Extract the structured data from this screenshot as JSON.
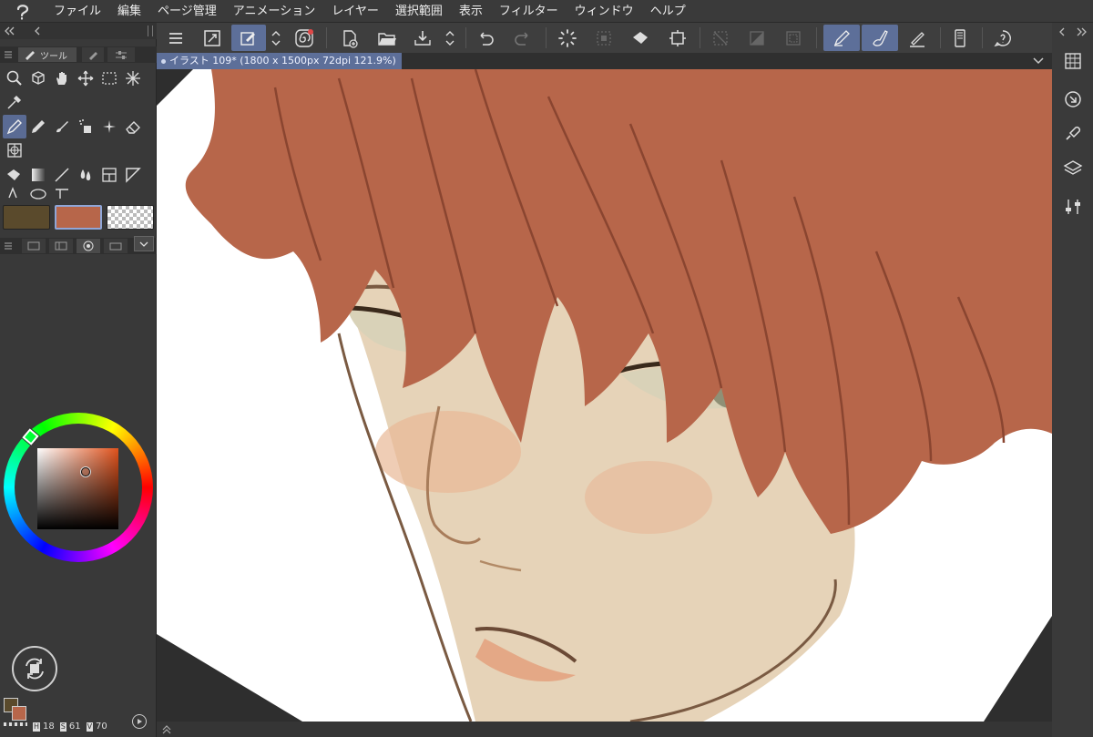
{
  "menubar": {
    "items": [
      "ファイル",
      "編集",
      "ページ管理",
      "アニメーション",
      "レイヤー",
      "選択範囲",
      "表示",
      "フィルター",
      "ウィンドウ",
      "ヘルプ"
    ]
  },
  "command_bar": {
    "icons": [
      "menu-icon",
      "fit-view-icon",
      "edit-canvas-icon",
      "updown-icon",
      "spiral-icon",
      "new-file-icon",
      "open-folder-icon",
      "save-icon",
      "updown-icon",
      "undo-icon",
      "redo-icon",
      "loading-icon",
      "deselect-icon",
      "fill-icon",
      "crop-icon",
      "clear-selection-icon",
      "tone-icon",
      "border-icon",
      "vector-pen-icon",
      "brush-icon",
      "ruler-pen-icon",
      "device-icon",
      "help-icon"
    ]
  },
  "document": {
    "tab_label": "イラスト 109* (1800 x 1500px 72dpi 121.9%)"
  },
  "tool_palette": {
    "tab_label": "ツール",
    "colors": {
      "main": "#5a4a2c",
      "sub": "#b7664a",
      "transparent": "checker"
    }
  },
  "status": {
    "h_label": "H",
    "h_value": "18",
    "s_label": "S",
    "s_value": "61",
    "v_label": "V",
    "v_value": "70"
  },
  "colors": {
    "accent": "#5d6f99",
    "hair": "#b7664a",
    "skin": "#e6d2b8"
  }
}
